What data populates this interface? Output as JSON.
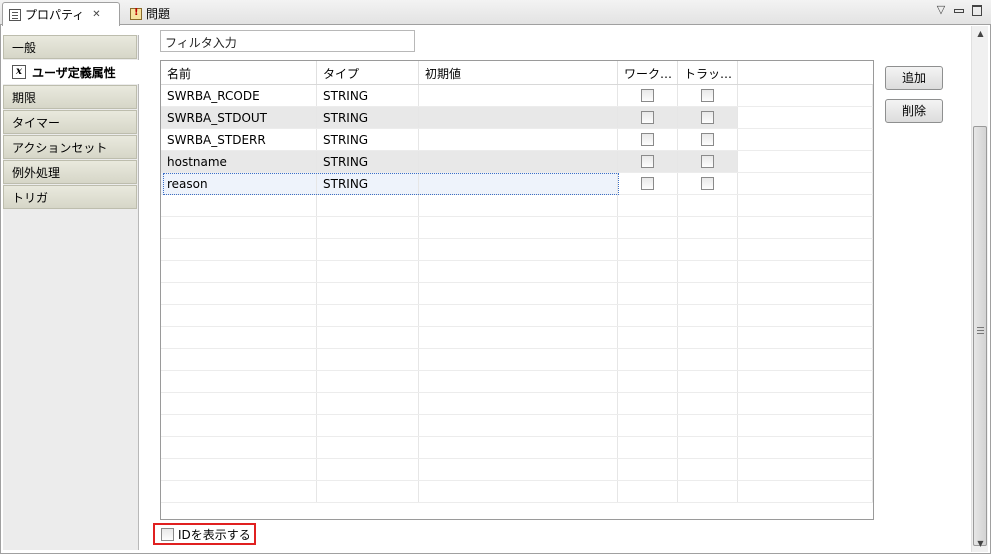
{
  "tabs": {
    "properties_label": "プロパティ",
    "problems_label": "問題"
  },
  "window_controls": {
    "menu_glyph": "▽"
  },
  "sidebar": {
    "items": [
      {
        "label": "一般"
      },
      {
        "label": "ユーザ定義属性"
      },
      {
        "label": "期限"
      },
      {
        "label": "タイマー"
      },
      {
        "label": "アクションセット"
      },
      {
        "label": "例外処理"
      },
      {
        "label": "トリガ"
      }
    ],
    "selected_icon_glyph": "x"
  },
  "filter": {
    "value": "フィルタ入力"
  },
  "table": {
    "columns": [
      "名前",
      "タイプ",
      "初期値",
      "ワーク…",
      "トラッ…"
    ],
    "rows": [
      {
        "name": "SWRBA_RCODE",
        "type": "STRING",
        "initial": ""
      },
      {
        "name": "SWRBA_STDOUT",
        "type": "STRING",
        "initial": ""
      },
      {
        "name": "SWRBA_STDERR",
        "type": "STRING",
        "initial": ""
      },
      {
        "name": "hostname",
        "type": "STRING",
        "initial": ""
      },
      {
        "name": "reason",
        "type": "STRING",
        "initial": ""
      }
    ]
  },
  "buttons": {
    "add_label": "追加",
    "delete_label": "削除"
  },
  "id_toggle": {
    "label": "IDを表示する",
    "highlight_color": "#e02020"
  },
  "colors": {
    "selection_outline": "#3b6fc7",
    "row_shade": "#e8e8e8"
  }
}
